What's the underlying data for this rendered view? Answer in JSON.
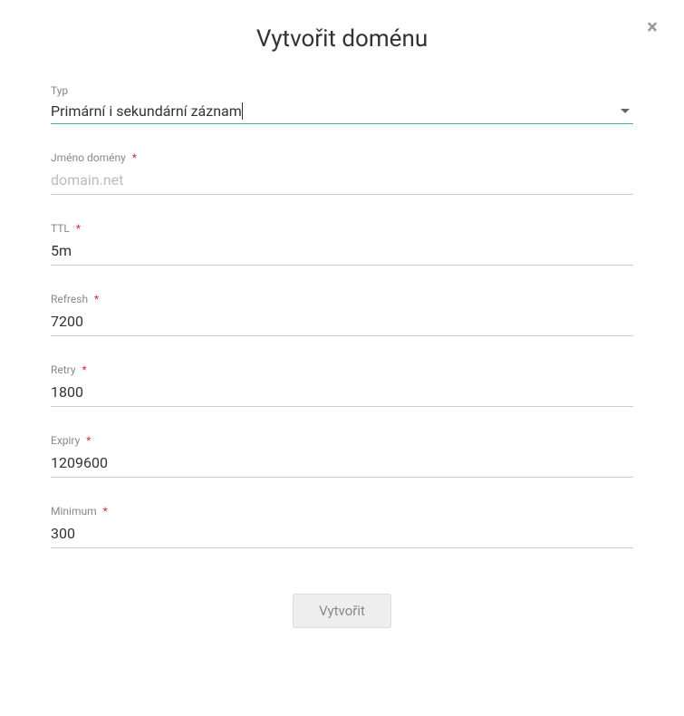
{
  "modal": {
    "title": "Vytvořit doménu",
    "close_icon": "×"
  },
  "form": {
    "type": {
      "label": "Typ",
      "value": "Primární i sekundární záznam",
      "required": false
    },
    "domain": {
      "label": "Jméno domény",
      "placeholder": "domain.net",
      "value": "",
      "required": true
    },
    "ttl": {
      "label": "TTL",
      "value": "5m",
      "required": true
    },
    "refresh": {
      "label": "Refresh",
      "value": "7200",
      "required": true
    },
    "retry": {
      "label": "Retry",
      "value": "1800",
      "required": true
    },
    "expiry": {
      "label": "Expiry",
      "value": "1209600",
      "required": true
    },
    "minimum": {
      "label": "Minimum",
      "value": "300",
      "required": true
    }
  },
  "button": {
    "submit_label": "Vytvořit"
  },
  "required_mark": "*"
}
